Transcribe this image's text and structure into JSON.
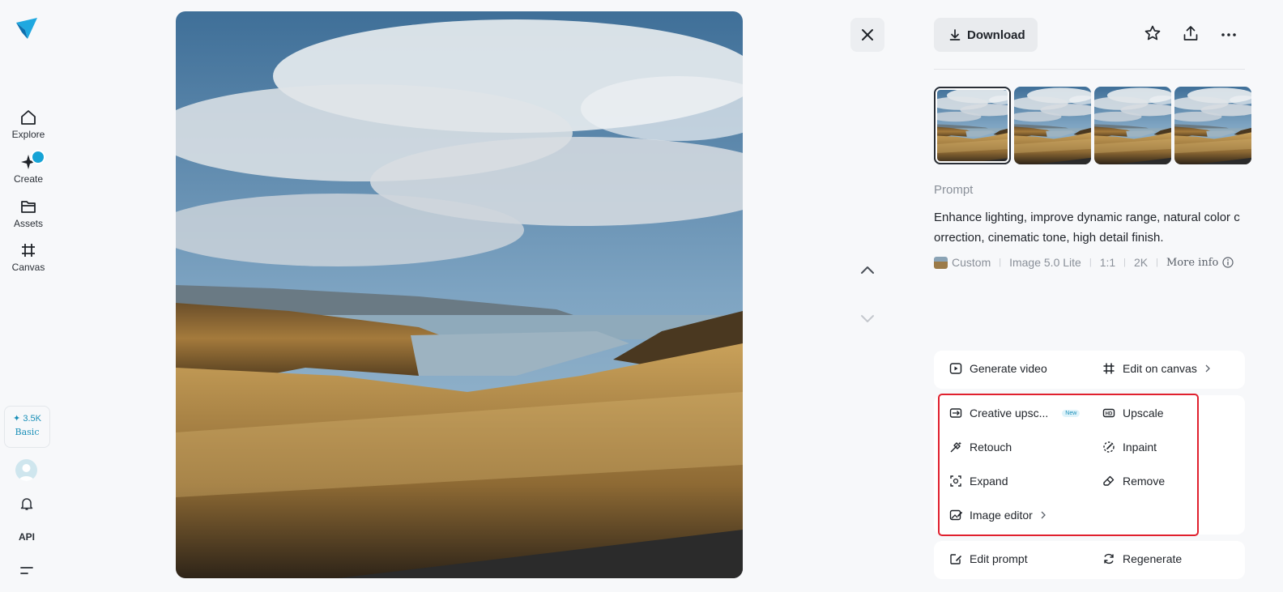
{
  "sidebar": {
    "items": [
      {
        "label": "Explore",
        "icon": "home-icon"
      },
      {
        "label": "Create",
        "icon": "create-sparkle-icon"
      },
      {
        "label": "Assets",
        "icon": "folder-icon"
      },
      {
        "label": "Canvas",
        "icon": "canvas-grid-icon"
      }
    ],
    "credits": {
      "amount": "✦ 3.5K",
      "plan": "Basic"
    },
    "api_label": "API"
  },
  "viewer": {
    "close_icon": "close-icon",
    "prev_icon": "chevron-up-icon",
    "next_icon": "chevron-down-icon"
  },
  "panel": {
    "download_label": "Download",
    "prompt_label": "Prompt",
    "prompt_text": "Enhance lighting, improve dynamic range, natural color correction, cinematic tone, high detail finish.",
    "meta": {
      "style": "Custom",
      "model": "Image 5.0 Lite",
      "ratio": "1:1",
      "resolution": "2K",
      "more_info": "More info"
    },
    "actions_primary": {
      "generate_video": "Generate video",
      "edit_on_canvas": "Edit on canvas"
    },
    "actions_tools": {
      "creative_upscale": "Creative upsc...",
      "new_tag": "New",
      "upscale": "Upscale",
      "retouch": "Retouch",
      "inpaint": "Inpaint",
      "expand": "Expand",
      "remove": "Remove",
      "image_editor": "Image editor"
    },
    "actions_bottom": {
      "edit_prompt": "Edit prompt",
      "regenerate": "Regenerate"
    }
  },
  "colors": {
    "accent": "#16a3d6",
    "highlight": "#e0202e",
    "background": "#f7f8fa"
  }
}
